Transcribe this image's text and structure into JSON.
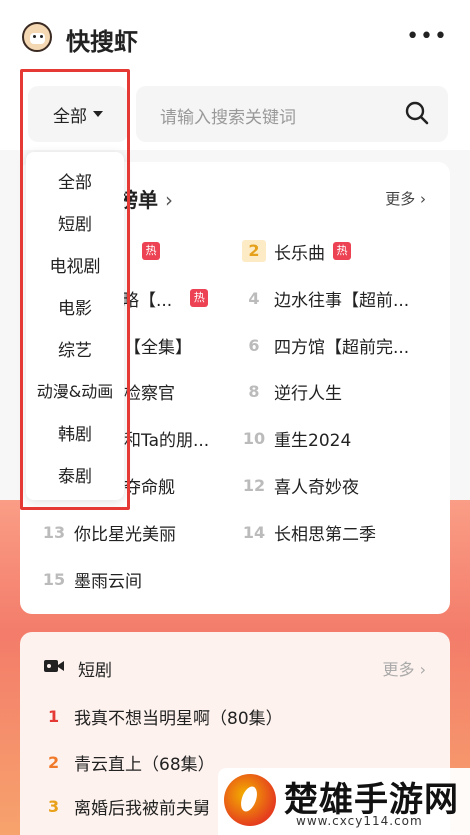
{
  "header": {
    "title": "快搜虾",
    "menu_icon": "more-dots-icon"
  },
  "search": {
    "category_selected": "全部",
    "placeholder": "请输入搜索关键词"
  },
  "category_dropdown": {
    "options": [
      "全部",
      "短剧",
      "电视剧",
      "电影",
      "综艺",
      "动漫&动画",
      "韩剧",
      "泰剧"
    ]
  },
  "hot_list": {
    "title": "榜单",
    "more": "更多 ›",
    "items": [
      {
        "rank": "",
        "title": "",
        "badge": "热"
      },
      {
        "rank": "2",
        "title": "长乐曲",
        "badge": "热"
      },
      {
        "rank": "",
        "title": "略【...",
        "badge": "热"
      },
      {
        "rank": "4",
        "title": "边水往事【超前..."
      },
      {
        "rank": "",
        "title": "【全集】"
      },
      {
        "rank": "6",
        "title": "四方馆【超前完..."
      },
      {
        "rank": "",
        "title": "检察官"
      },
      {
        "rank": "8",
        "title": "逆行人生"
      },
      {
        "rank": "",
        "title": "和Ta的朋..."
      },
      {
        "rank": "10",
        "title": "重生2024"
      },
      {
        "rank": "",
        "title": "夺命舰"
      },
      {
        "rank": "12",
        "title": "喜人奇妙夜"
      },
      {
        "rank": "13",
        "title": "你比星光美丽"
      },
      {
        "rank": "14",
        "title": "长相思第二季"
      },
      {
        "rank": "15",
        "title": "墨雨云间"
      }
    ]
  },
  "drama_section": {
    "icon": "video-camera-icon",
    "title": "短剧",
    "more": "更多 ›",
    "items": [
      {
        "rank": "1",
        "title": "我真不想当明星啊（80集）",
        "color": "#e53935"
      },
      {
        "rank": "2",
        "title": "青云直上（68集）",
        "color": "#f07a2a"
      },
      {
        "rank": "3",
        "title": "离婚后我被前夫舅",
        "color": "#e9a11a"
      }
    ]
  },
  "watermark": {
    "title": "楚雄手游网",
    "url": "www.cxcy114.com"
  },
  "colors": {
    "accent_red": "#e53935",
    "hot_badge": "#ec4253",
    "rank_gold": "#e5a11c"
  }
}
